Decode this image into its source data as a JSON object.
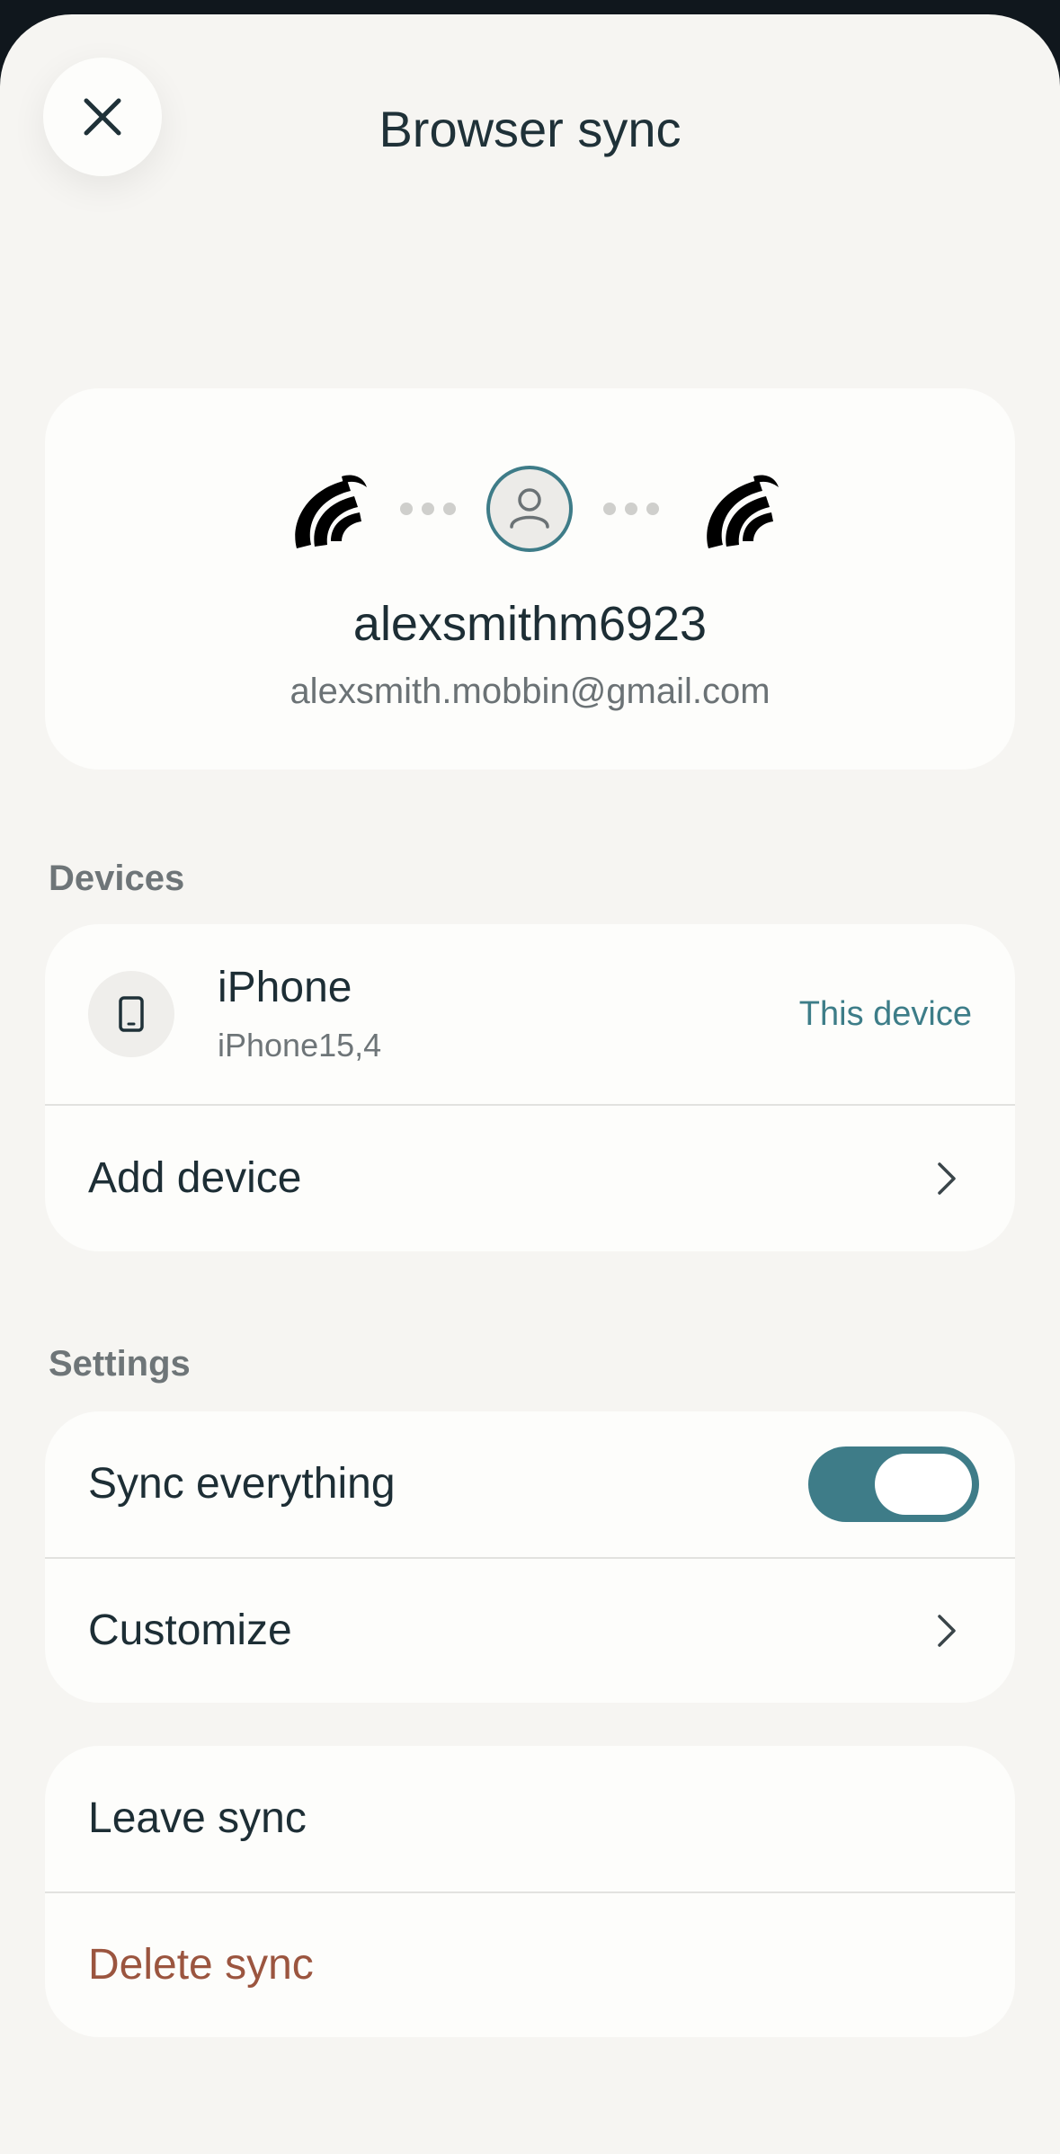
{
  "header": {
    "title": "Browser sync",
    "close_icon": "close-icon"
  },
  "profile": {
    "username": "alexsmithm6923",
    "email": "alexsmith.mobbin@gmail.com",
    "left_logo": "browser-logo-icon",
    "right_logo": "browser-logo-icon",
    "center_icon": "user-avatar-icon"
  },
  "devices": {
    "section_label": "Devices",
    "items": [
      {
        "name": "iPhone",
        "model": "iPhone15,4",
        "badge": "This device",
        "icon": "phone-icon"
      }
    ],
    "add_label": "Add device"
  },
  "settings": {
    "section_label": "Settings",
    "sync_everything_label": "Sync everything",
    "sync_everything_on": true,
    "customize_label": "Customize"
  },
  "actions": {
    "leave_label": "Leave sync",
    "delete_label": "Delete sync"
  },
  "colors": {
    "accent": "#3e7c88",
    "danger": "#9b553f",
    "background": "#f6f5f2",
    "card": "#fdfdfb"
  }
}
